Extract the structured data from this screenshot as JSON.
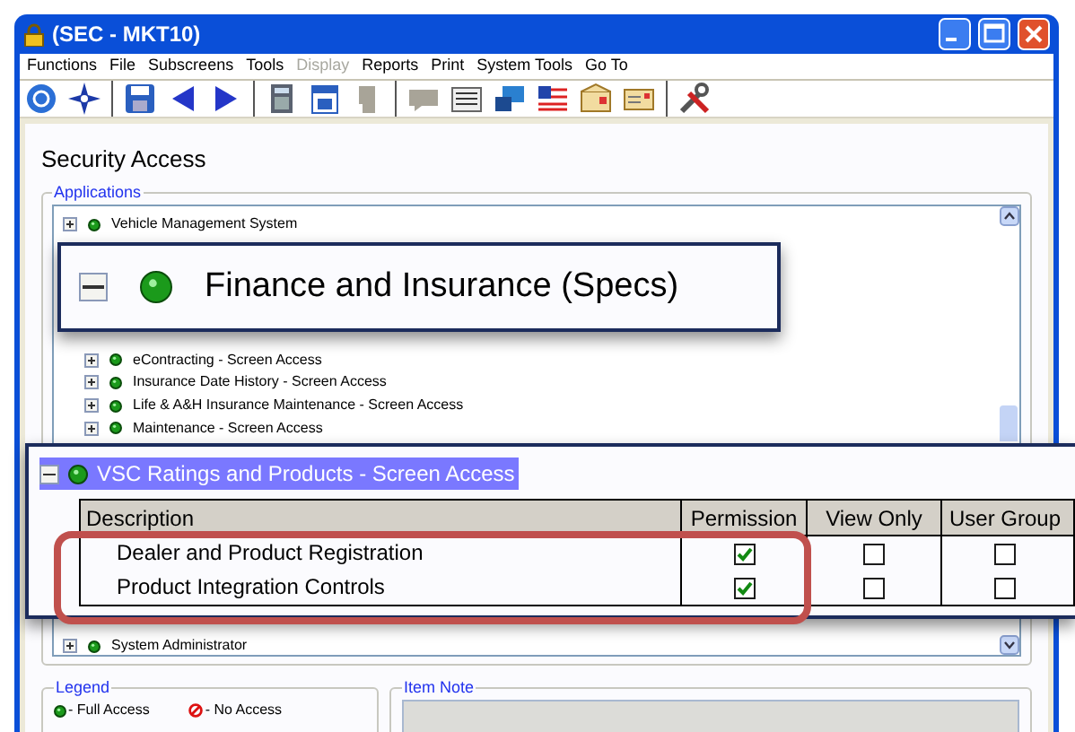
{
  "window": {
    "title": "(SEC - MKT10)"
  },
  "menu": [
    {
      "label": "Functions",
      "disabled": false
    },
    {
      "label": "File",
      "disabled": false
    },
    {
      "label": "Subscreens",
      "disabled": false
    },
    {
      "label": "Tools",
      "disabled": false
    },
    {
      "label": "Display",
      "disabled": true
    },
    {
      "label": "Reports",
      "disabled": false
    },
    {
      "label": "Print",
      "disabled": false
    },
    {
      "label": "System Tools",
      "disabled": false
    },
    {
      "label": "Go To",
      "disabled": false
    }
  ],
  "page_title": "Security Access",
  "applications": {
    "label": "Applications",
    "tree_top": [
      {
        "label": "Vehicle Management System",
        "expanded": false
      }
    ],
    "tree_middle": [
      {
        "label": "eContracting - Screen Access",
        "expanded": false
      },
      {
        "label": "Insurance Date History - Screen Access",
        "expanded": false
      },
      {
        "label": "Life & A&H Insurance Maintenance - Screen Access",
        "expanded": false
      },
      {
        "label": "Maintenance - Screen Access",
        "expanded": false
      }
    ],
    "tree_bottom": [
      {
        "label": "System Administrator",
        "expanded": false
      }
    ]
  },
  "callout_1": {
    "label": "Finance and Insurance (Specs)",
    "expanded": true
  },
  "callout_2": {
    "item": {
      "label": "VSC Ratings and Products - Screen Access",
      "expanded": true,
      "selected": true
    },
    "columns": [
      "Description",
      "Permission",
      "View Only",
      "User Group"
    ],
    "rows": [
      {
        "description": "Dealer and Product Registration",
        "permission": true,
        "view_only": false,
        "user_group": false
      },
      {
        "description": "Product Integration Controls",
        "permission": true,
        "view_only": false,
        "user_group": false
      }
    ]
  },
  "legend": {
    "label": "Legend",
    "items": [
      {
        "kind": "full",
        "label": "- Full Access"
      },
      {
        "kind": "none",
        "label": "- No Access"
      }
    ]
  },
  "item_note": {
    "label": "Item Note"
  }
}
